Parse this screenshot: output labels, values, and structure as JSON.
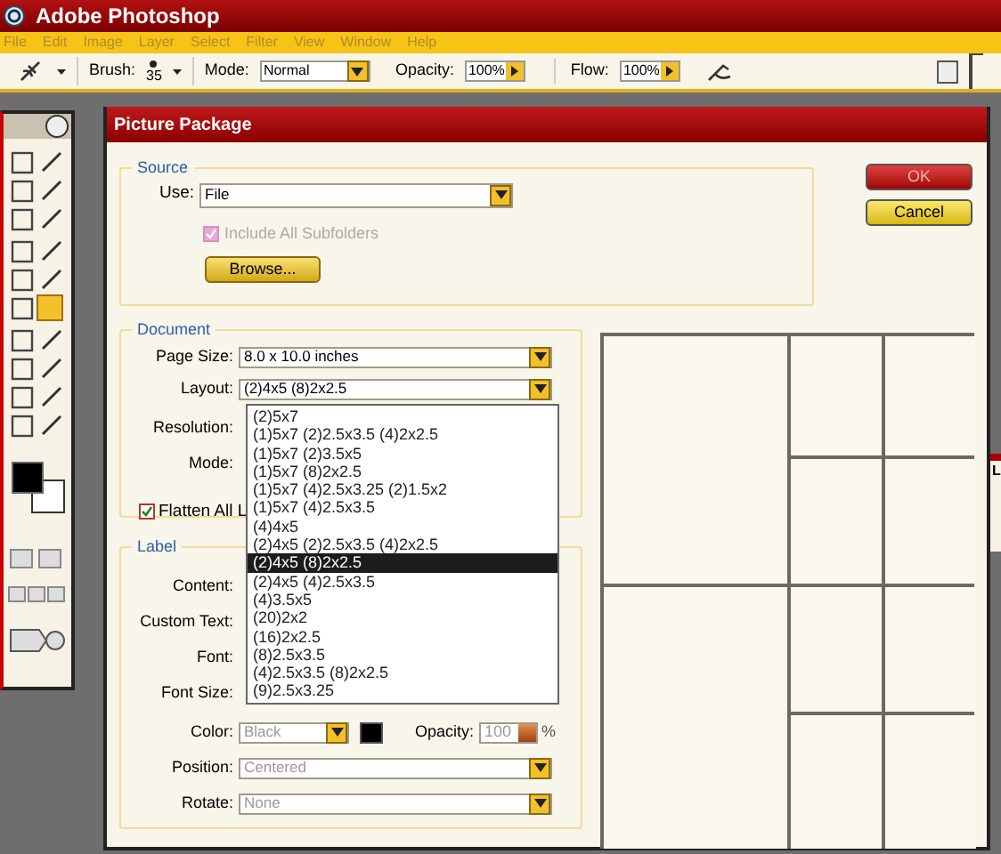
{
  "app": {
    "title": "Adobe Photoshop"
  },
  "menu": [
    "File",
    "Edit",
    "Image",
    "Layer",
    "Select",
    "Filter",
    "View",
    "Window",
    "Help"
  ],
  "options_bar": {
    "brush_label": "Brush:",
    "brush_size": "35",
    "mode_label": "Mode:",
    "mode": "Normal",
    "opacity_label": "Opacity:",
    "opacity": "100%",
    "flow_label": "Flow:",
    "flow": "100%"
  },
  "background_panel": {
    "text": "L"
  },
  "dialog": {
    "title": "Picture Package",
    "buttons": [
      {
        "label": "OK",
        "kind": "primary"
      },
      {
        "label": "Cancel",
        "kind": "secondary"
      }
    ],
    "source": {
      "title": "Source",
      "use_label": "Use:",
      "use": "File",
      "include_subfolders": {
        "label": "Include All Subfolders",
        "checked": true,
        "disabled": true
      },
      "browse": "Browse..."
    },
    "document": {
      "title": "Document",
      "page_size_label": "Page Size:",
      "page_size": "8.0 x 10.0 inches",
      "layout_label": "Layout:",
      "layout": "(2)4x5 (8)2x2.5",
      "resolution_label": "Resolution:",
      "mode_label": "Mode:",
      "flatten": {
        "label": "Flatten All L",
        "checked": true
      }
    },
    "layout_dropdown": [
      {
        "label": "(2)5x7",
        "selected": false
      },
      {
        "label": "(1)5x7 (2)2.5x3.5 (4)2x2.5",
        "selected": false
      },
      {
        "label": "(1)5x7 (2)3.5x5",
        "selected": false
      },
      {
        "label": "(1)5x7 (8)2x2.5",
        "selected": false
      },
      {
        "label": "(1)5x7 (4)2.5x3.25 (2)1.5x2",
        "selected": false
      },
      {
        "label": "(1)5x7 (4)2.5x3.5",
        "selected": false
      },
      {
        "label": "(4)4x5",
        "selected": false
      },
      {
        "label": "(2)4x5 (2)2.5x3.5 (4)2x2.5",
        "selected": false
      },
      {
        "label": "(2)4x5 (8)2x2.5",
        "selected": true
      },
      {
        "label": "(2)4x5 (4)2.5x3.5",
        "selected": false
      },
      {
        "label": "(4)3.5x5",
        "selected": false
      },
      {
        "label": "(20)2x2",
        "selected": false
      },
      {
        "label": "(16)2x2.5",
        "selected": false
      },
      {
        "label": "(8)2.5x3.5",
        "selected": false
      },
      {
        "label": "(4)2.5x3.5 (8)2x2.5",
        "selected": false
      },
      {
        "label": "(9)2.5x3.25",
        "selected": false
      }
    ],
    "label_section": {
      "title": "Label",
      "disabled": true,
      "content_label": "Content:",
      "custom_text_label": "Custom Text:",
      "font_label": "Font:",
      "font_size_label": "Font Size:",
      "color_label": "Color:",
      "color_name": "Black",
      "opacity_label": "Opacity:",
      "opacity": "100",
      "percent": "%",
      "position_label": "Position:",
      "position": "Centered",
      "rotate_label": "Rotate:",
      "rotate": "None"
    }
  }
}
